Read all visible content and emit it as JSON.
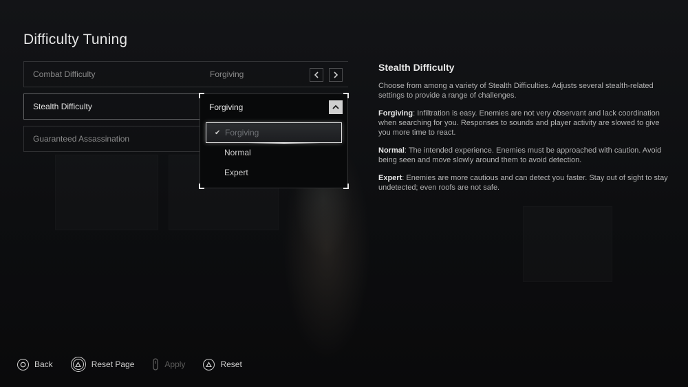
{
  "page_title": "Difficulty Tuning",
  "settings": [
    {
      "label": "Combat Difficulty",
      "value": "Forgiving"
    },
    {
      "label": "Stealth Difficulty",
      "value": "Forgiving"
    },
    {
      "label": "Guaranteed Assassination",
      "value": ""
    }
  ],
  "dropdown": {
    "options": [
      {
        "label": "Forgiving",
        "selected": true
      },
      {
        "label": "Normal",
        "selected": false
      },
      {
        "label": "Expert",
        "selected": false
      }
    ]
  },
  "info": {
    "title": "Stealth Difficulty",
    "intro": "Choose from among a variety of Stealth Difficulties. Adjusts several stealth-related settings to provide a range of challenges.",
    "forgiving_term": "Forgiving",
    "forgiving_text": ": Infiltration is easy. Enemies are not very observant and lack coordination when searching for you. Responses to sounds and player activity are slowed to give you more time to react.",
    "normal_term": "Normal",
    "normal_text": ": The intended experience. Enemies must be approached with caution. Avoid being seen and move slowly around them to avoid detection.",
    "expert_term": "Expert",
    "expert_text": ": Enemies are more cautious and can detect you faster. Stay out of sight to stay undetected; even roofs are not safe."
  },
  "footer": {
    "back": "Back",
    "reset_page": "Reset Page",
    "apply": "Apply",
    "reset": "Reset"
  },
  "icons": {
    "back": "circle-button-icon",
    "reset_page": "triangle-button-icon",
    "apply": "touchpad-icon",
    "reset": "triangle-button-icon",
    "prev": "chevron-left-icon",
    "next": "chevron-right-icon",
    "toggle": "chevron-up-icon",
    "check": "checkmark-icon"
  }
}
